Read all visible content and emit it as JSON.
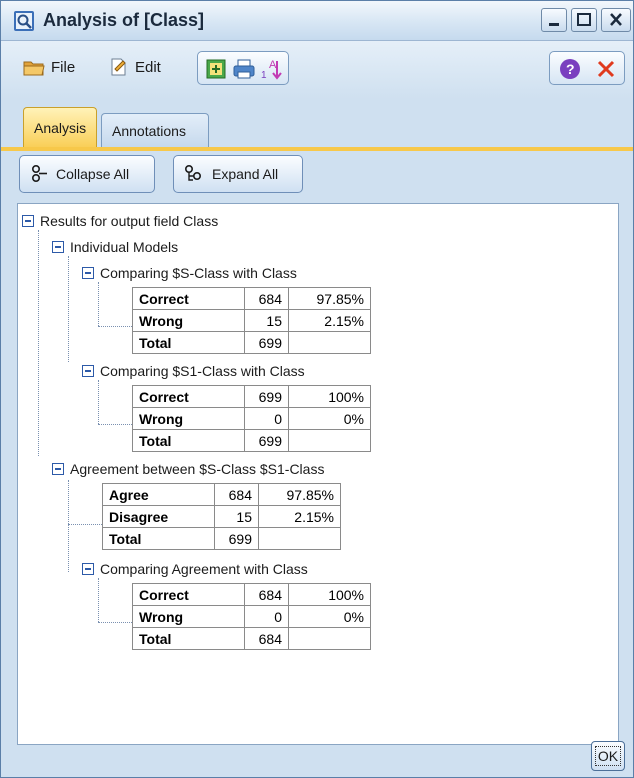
{
  "window": {
    "title": "Analysis of [Class]"
  },
  "toolbar": {
    "file_label": "File",
    "edit_label": "Edit"
  },
  "tabs": [
    {
      "label": "Analysis"
    },
    {
      "label": "Annotations"
    }
  ],
  "buttons": {
    "collapse_all": "Collapse All",
    "expand_all": "Expand All",
    "ok": "OK"
  },
  "tree": {
    "root": "Results for output field Class",
    "individual": "Individual Models",
    "cmp_s": "Comparing $S-Class with Class",
    "cmp_s1": "Comparing $S1-Class with Class",
    "agreement": "Agreement between  $S-Class $S1-Class",
    "cmp_agree": "Comparing Agreement with Class"
  },
  "tables": {
    "s": [
      {
        "label": "Correct",
        "count": "684",
        "pct": "97.85%"
      },
      {
        "label": "Wrong",
        "count": "15",
        "pct": "2.15%"
      },
      {
        "label": "Total",
        "count": "699",
        "pct": ""
      }
    ],
    "s1": [
      {
        "label": "Correct",
        "count": "699",
        "pct": "100%"
      },
      {
        "label": "Wrong",
        "count": "0",
        "pct": "0%"
      },
      {
        "label": "Total",
        "count": "699",
        "pct": ""
      }
    ],
    "agreement": [
      {
        "label": "Agree",
        "count": "684",
        "pct": "97.85%"
      },
      {
        "label": "Disagree",
        "count": "15",
        "pct": "2.15%"
      },
      {
        "label": "Total",
        "count": "699",
        "pct": ""
      }
    ],
    "agree_class": [
      {
        "label": "Correct",
        "count": "684",
        "pct": "100%"
      },
      {
        "label": "Wrong",
        "count": "0",
        "pct": "0%"
      },
      {
        "label": "Total",
        "count": "684",
        "pct": ""
      }
    ]
  },
  "colors": {
    "active_tab": "#f9cf58",
    "window_bg": "#cfe0f0",
    "close_x": "#e03a1e"
  }
}
